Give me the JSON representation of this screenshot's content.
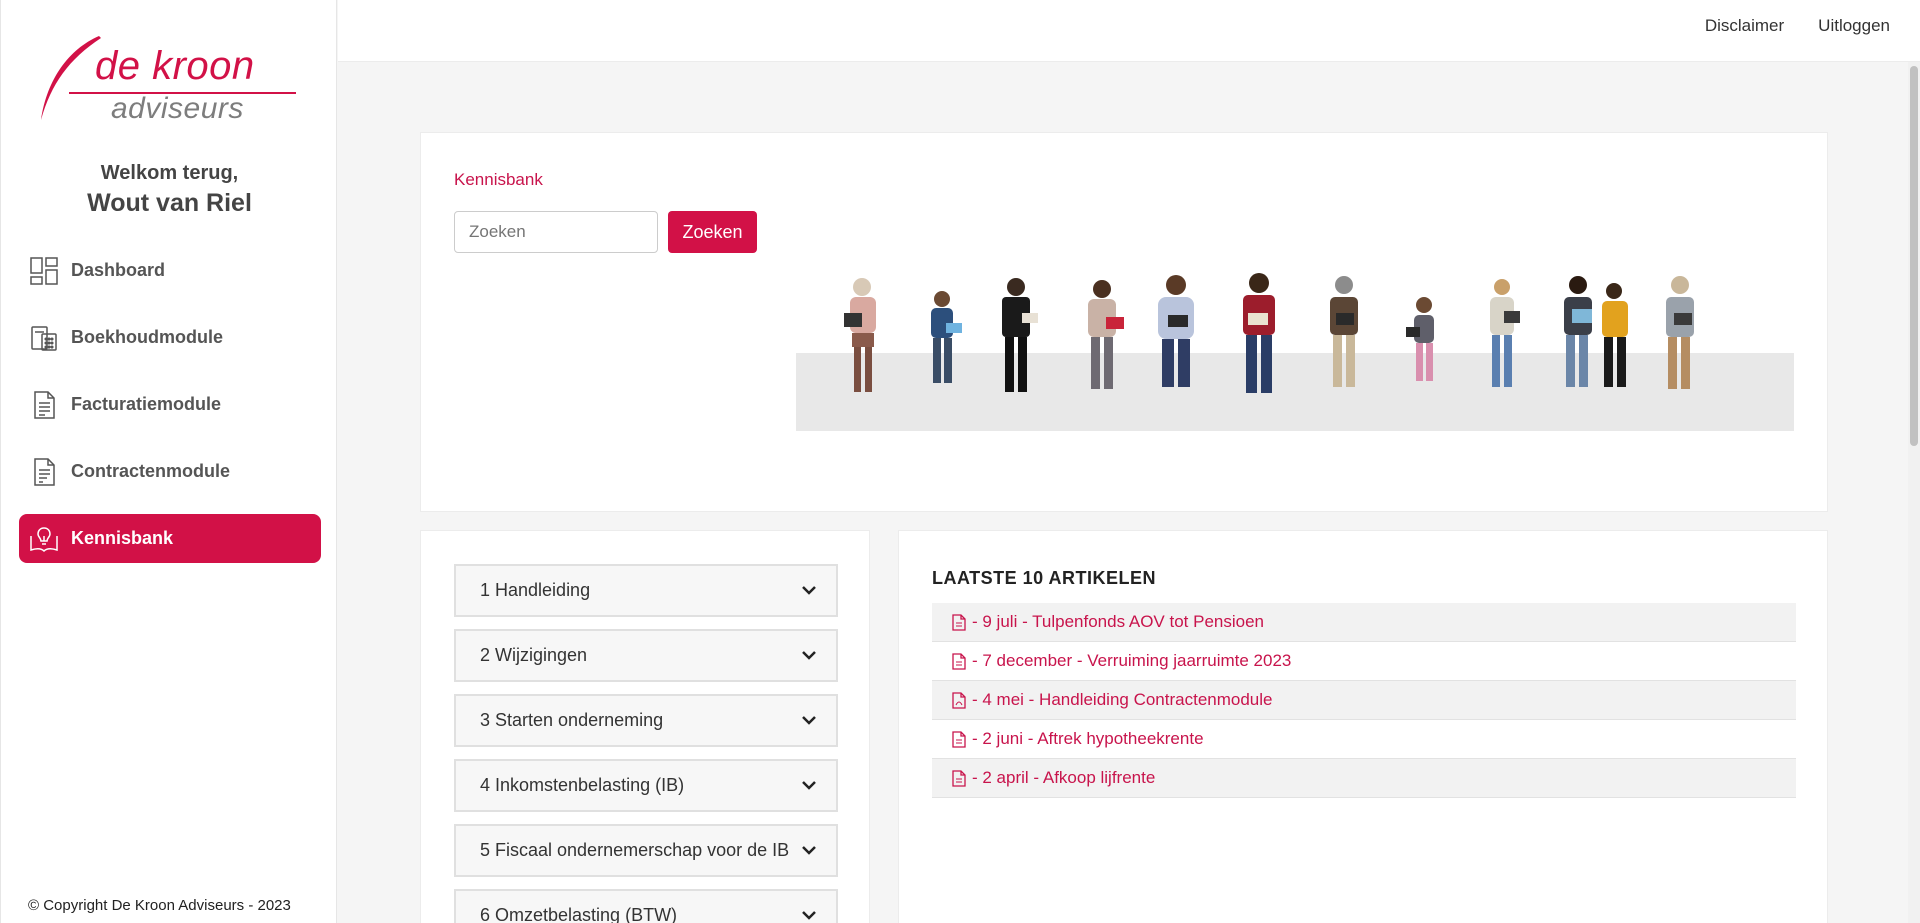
{
  "brand": {
    "name": "de kroon",
    "sub": "adviseurs",
    "accent": "#d21147"
  },
  "welcome": {
    "greeting": "Welkom terug,",
    "user": "Wout van Riel"
  },
  "nav": [
    {
      "label": "Dashboard",
      "icon": "dashboard-icon"
    },
    {
      "label": "Boekhoudmodule",
      "icon": "calculator-icon"
    },
    {
      "label": "Facturatiemodule",
      "icon": "document-icon"
    },
    {
      "label": "Contractenmodule",
      "icon": "contract-icon"
    },
    {
      "label": "Kennisbank",
      "icon": "lightbulb-book-icon",
      "active": true
    }
  ],
  "copyright": "© Copyright De Kroon Adviseurs - 2023",
  "topbar": {
    "disclaimer": "Disclaimer",
    "logout": "Uitloggen"
  },
  "kennisbank": {
    "title": "Kennisbank",
    "search_placeholder": "Zoeken",
    "search_button": "Zoeken"
  },
  "categories": [
    "1 Handleiding",
    "2 Wijzigingen",
    "3 Starten onderneming",
    "4 Inkomstenbelasting (IB)",
    "5 Fiscaal ondernemerschap voor de IB",
    "6 Omzetbelasting (BTW)"
  ],
  "articles": {
    "title": "LAATSTE 10 ARTIKELEN",
    "items": [
      "- 9 juli - Tulpenfonds AOV tot Pensioen",
      "- 7 december - Verruiming jaarruimte 2023",
      "- 4 mei - Handleiding Contractenmodule",
      "- 2 juni - Aftrek hypotheekrente",
      "- 2 april - Afkoop lijfrente"
    ]
  }
}
